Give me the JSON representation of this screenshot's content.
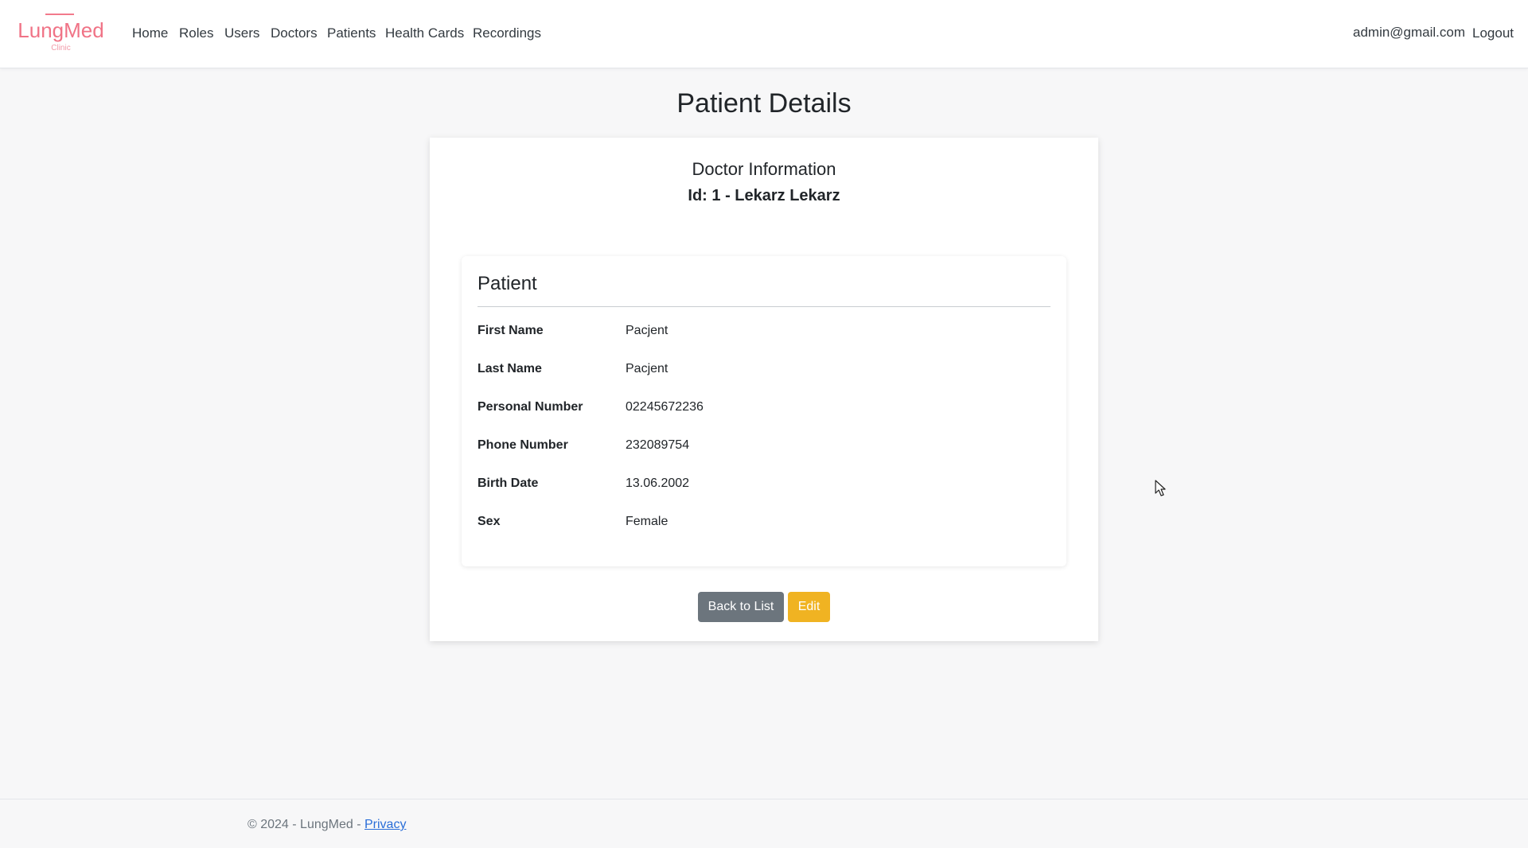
{
  "brand": {
    "name": "LungMed",
    "subtitle": "Clinic"
  },
  "nav": {
    "items": [
      "Home",
      "Roles",
      "Users",
      "Doctors",
      "Patients",
      "Health Cards",
      "Recordings"
    ],
    "user_email": "admin@gmail.com",
    "logout": "Logout"
  },
  "page": {
    "title": "Patient Details"
  },
  "doctor": {
    "heading": "Doctor Information",
    "id_line": "Id: 1 - Lekarz Lekarz"
  },
  "patient": {
    "title": "Patient",
    "fields": [
      {
        "label": "First Name",
        "value": "Pacjent"
      },
      {
        "label": "Last Name",
        "value": "Pacjent"
      },
      {
        "label": "Personal Number",
        "value": "02245672236"
      },
      {
        "label": "Phone Number",
        "value": "232089754"
      },
      {
        "label": "Birth Date",
        "value": "13.06.2002"
      },
      {
        "label": "Sex",
        "value": "Female"
      }
    ]
  },
  "actions": {
    "back": "Back to List",
    "edit": "Edit"
  },
  "footer": {
    "text": "© 2024 - LungMed - ",
    "privacy": "Privacy"
  },
  "colors": {
    "brand": "#f07386",
    "back_button": "#6c757d",
    "edit_button": "#f0b322",
    "link": "#2a6ed8"
  },
  "icons": {
    "cursor": "mouse-pointer-icon"
  }
}
